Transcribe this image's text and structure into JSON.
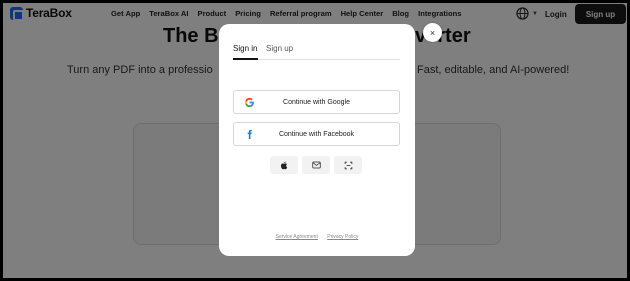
{
  "brand": {
    "name": "TeraBox"
  },
  "nav": {
    "items": [
      "Get App",
      "TeraBox AI",
      "Product",
      "Pricing",
      "Referral program",
      "Help Center",
      "Blog",
      "Integrations"
    ]
  },
  "header": {
    "login_label": "Login",
    "signup_label": "Sign up"
  },
  "hero": {
    "title_left": "The Be",
    "title_right": "verter",
    "subtitle_left": "Turn any PDF into a professio",
    "subtitle_right": "Fast, editable, and AI-powered!"
  },
  "modal": {
    "close_icon": "×",
    "tabs": [
      {
        "label": "Sign in",
        "active": true
      },
      {
        "label": "Sign up",
        "active": false
      }
    ],
    "google_label": "Continue with Google",
    "facebook_label": "Continue with Facebook",
    "alt_buttons": [
      "apple-icon",
      "mail-icon",
      "scan-icon"
    ],
    "footer": {
      "service_agreement": "Service Agreement",
      "privacy_policy": "Privacy Policy"
    }
  },
  "colors": {
    "brand_blue": "#1f6ff2",
    "facebook_blue": "#1877f2",
    "dark_button": "#1a1a1a"
  }
}
